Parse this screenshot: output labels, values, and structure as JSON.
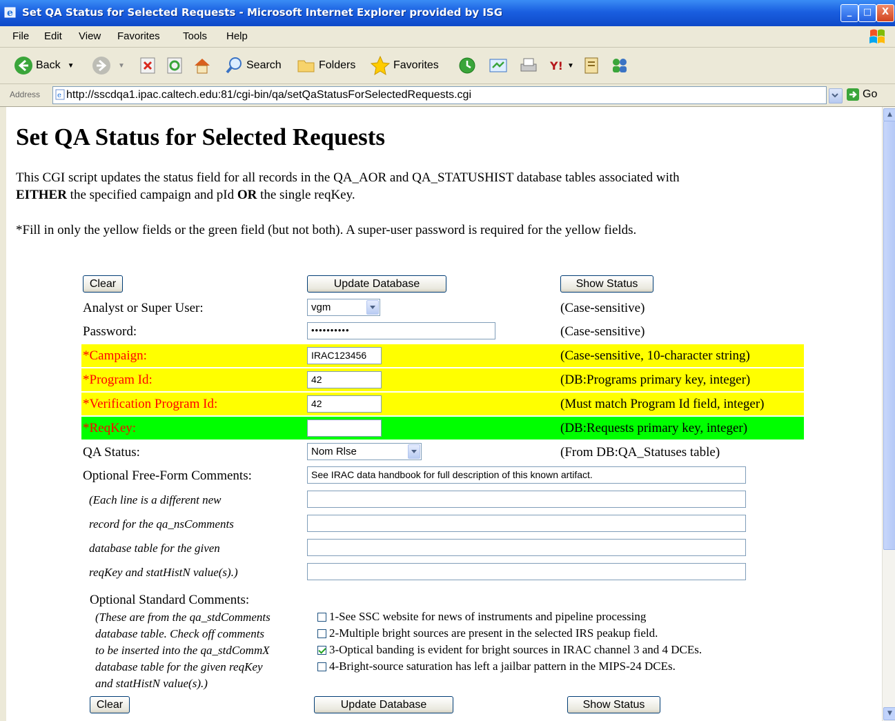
{
  "window": {
    "title": "Set QA Status for Selected Requests - Microsoft Internet Explorer provided by ISG",
    "min_label": "_",
    "max_label": "□",
    "close_label": "X"
  },
  "menu": [
    "File",
    "Edit",
    "View",
    "Favorites",
    "Tools",
    "Help"
  ],
  "toolbar": {
    "back": "Back",
    "search": "Search",
    "folders": "Folders",
    "favorites": "Favorites"
  },
  "address": {
    "label": "Address",
    "url": "http://sscdqa1.ipac.caltech.edu:81/cgi-bin/qa/setQaStatusForSelectedRequests.cgi",
    "go": "Go"
  },
  "page": {
    "heading": "Set QA Status for Selected Requests",
    "intro_1": "This CGI script updates the status field for all records in the QA_AOR and QA_STATUSHIST database tables associated with",
    "intro_2a": "EITHER",
    "intro_2b": " the specified campaign and pId ",
    "intro_2c": "OR",
    "intro_2d": " the single reqKey.",
    "instructions": "*Fill in only the yellow fields or the green field (but not both). A super-user password is required for the yellow fields."
  },
  "buttons": {
    "clear": "Clear",
    "update": "Update Database",
    "show_status": "Show Status"
  },
  "form": {
    "analyst_label": "Analyst or Super User:",
    "analyst_value": "vgm",
    "analyst_note": "(Case-sensitive)",
    "password_label": "Password:",
    "password_value": "••••••••••",
    "password_note": "(Case-sensitive)",
    "campaign_label": "*Campaign:",
    "campaign_value": "IRAC123456",
    "campaign_note": "(Case-sensitive, 10-character string)",
    "program_label": "*Program Id:",
    "program_value": "42",
    "program_note": "(DB:Programs primary key, integer)",
    "verify_label": "*Verification Program Id:",
    "verify_value": "42",
    "verify_note": "(Must match Program Id field, integer)",
    "reqkey_label": "*ReqKey:",
    "reqkey_value": "",
    "reqkey_note": "(DB:Requests primary key, integer)",
    "qa_status_label": "QA Status:",
    "qa_status_value": "Nom Rlse",
    "qa_status_note": "(From DB:QA_Statuses table)",
    "comments_label": "Optional Free-Form Comments:",
    "comments": [
      "See IRAC data handbook for full description of this known  artifact.",
      "",
      "",
      "",
      ""
    ],
    "comments_help": [
      "(Each line is a different new",
      "record for the qa_nsComments",
      "database table for the given",
      "reqKey and statHistN value(s).)"
    ],
    "std_label": "Optional Standard Comments:",
    "std_help": [
      "(These are from the qa_stdComments",
      "database table. Check off comments",
      "to be inserted into the qa_stdCommX",
      "database table for the given reqKey",
      "and statHistN value(s).)"
    ],
    "std_options": [
      {
        "label": "1-See SSC website for news of instruments and pipeline processing",
        "checked": false
      },
      {
        "label": "2-Multiple bright sources are present in the selected IRS peakup field.",
        "checked": false
      },
      {
        "label": "3-Optical banding is evident for bright sources in IRAC channel 3 and 4 DCEs.",
        "checked": true
      },
      {
        "label": "4-Bright-source saturation has left a jailbar pattern in the MIPS-24 DCEs.",
        "checked": false
      }
    ]
  }
}
